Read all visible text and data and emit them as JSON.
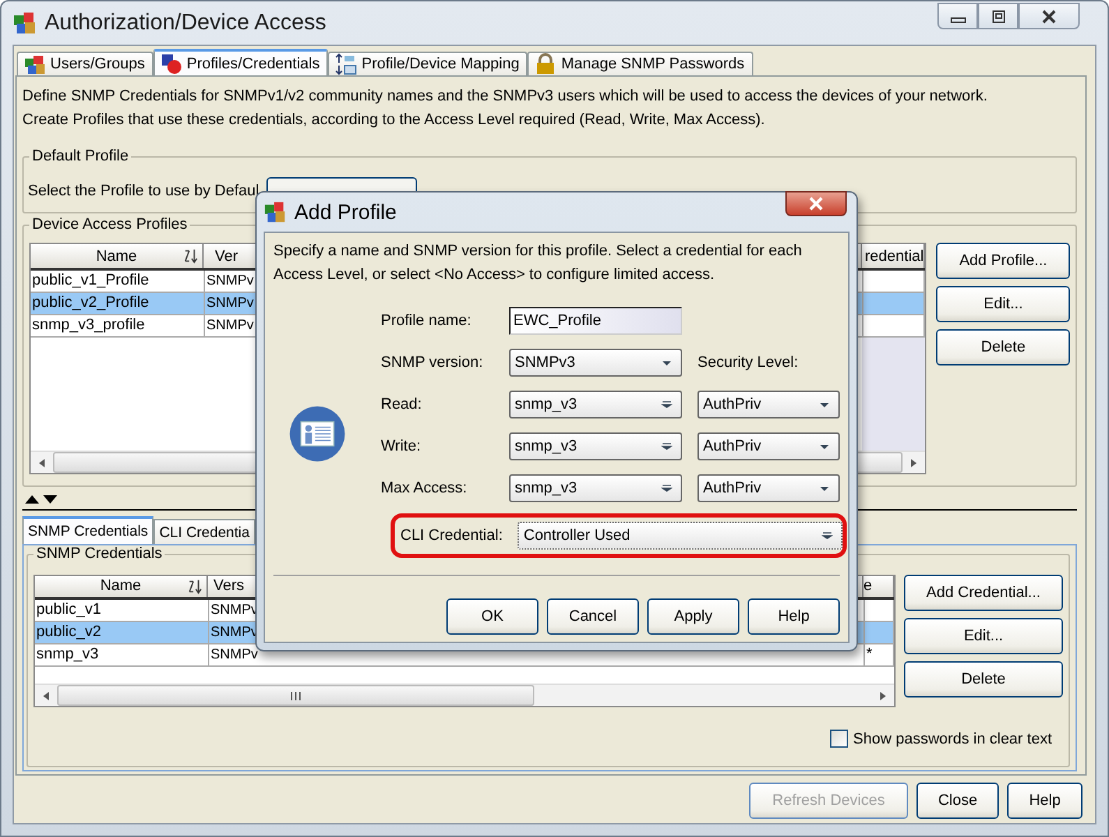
{
  "window": {
    "title": "Authorization/Device Access"
  },
  "tabs": [
    {
      "label": "Users/Groups",
      "selected": false,
      "kind": "users"
    },
    {
      "label": "Profiles/Credentials",
      "selected": true,
      "kind": "profiles"
    },
    {
      "label": "Profile/Device Mapping",
      "selected": false,
      "kind": "mapping"
    },
    {
      "label": "Manage SNMP Passwords",
      "selected": false,
      "kind": "lock"
    }
  ],
  "description": [
    "Define SNMP Credentials for SNMPv1/v2 community names and the SNMPv3 users which will be used to access the devices of your network.",
    "Create Profiles that use these credentials, according to the Access Level required (Read, Write, Max Access)."
  ],
  "default_profile": {
    "title": "Default Profile",
    "label": "Select the Profile to use by Defaul"
  },
  "device_access_profiles": {
    "title": "Device Access Profiles",
    "columns": [
      "Name",
      "Ver",
      "redential"
    ],
    "rows": [
      {
        "name": "public_v1_Profile",
        "version": "SNMPv",
        "selected": false
      },
      {
        "name": "public_v2_Profile",
        "version": "SNMPv",
        "selected": true
      },
      {
        "name": "snmp_v3_profile",
        "version": "SNMPv",
        "selected": false
      }
    ],
    "buttons": [
      "Add Profile...",
      "Edit...",
      "Delete"
    ]
  },
  "lower_tabs": [
    {
      "label": "SNMP Credentials",
      "selected": true
    },
    {
      "label": "CLI Credentia",
      "selected": false
    }
  ],
  "snmp_credentials": {
    "title": "SNMP Credentials",
    "columns": [
      "Name",
      "Vers",
      "e"
    ],
    "rows": [
      {
        "name": "public_v1",
        "version": "SNMPv",
        "last": "",
        "selected": false
      },
      {
        "name": "public_v2",
        "version": "SNMPv",
        "last": "",
        "selected": true
      },
      {
        "name": "snmp_v3",
        "version": "SNMPv",
        "last": "*",
        "selected": false
      }
    ],
    "buttons": [
      "Add Credential...",
      "Edit...",
      "Delete"
    ],
    "show_passwords": {
      "label": "Show passwords in clear text",
      "checked": false
    }
  },
  "footer_buttons": [
    {
      "label": "Refresh Devices",
      "disabled": true
    },
    {
      "label": "Close",
      "disabled": false
    },
    {
      "label": "Help",
      "disabled": false
    }
  ],
  "dialog": {
    "title": "Add Profile",
    "description": "Specify a name and SNMP version for this profile.  Select a credential for each Access Level, or select <No Access> to configure limited access.",
    "profile_name": {
      "label": "Profile name:",
      "value": "EWC_Profile"
    },
    "snmp_version": {
      "label": "SNMP version:",
      "value": "SNMPv3"
    },
    "security_level_label": "Security Level:",
    "access": [
      {
        "label": "Read:",
        "credential": "snmp_v3",
        "security": "AuthPriv"
      },
      {
        "label": "Write:",
        "credential": "snmp_v3",
        "security": "AuthPriv"
      },
      {
        "label": "Max Access:",
        "credential": "snmp_v3",
        "security": "AuthPriv"
      }
    ],
    "cli_credential": {
      "label": "CLI Credential:",
      "value": "Controller Used",
      "highlighted": true
    },
    "buttons": [
      "OK",
      "Cancel",
      "Apply",
      "Help"
    ]
  }
}
